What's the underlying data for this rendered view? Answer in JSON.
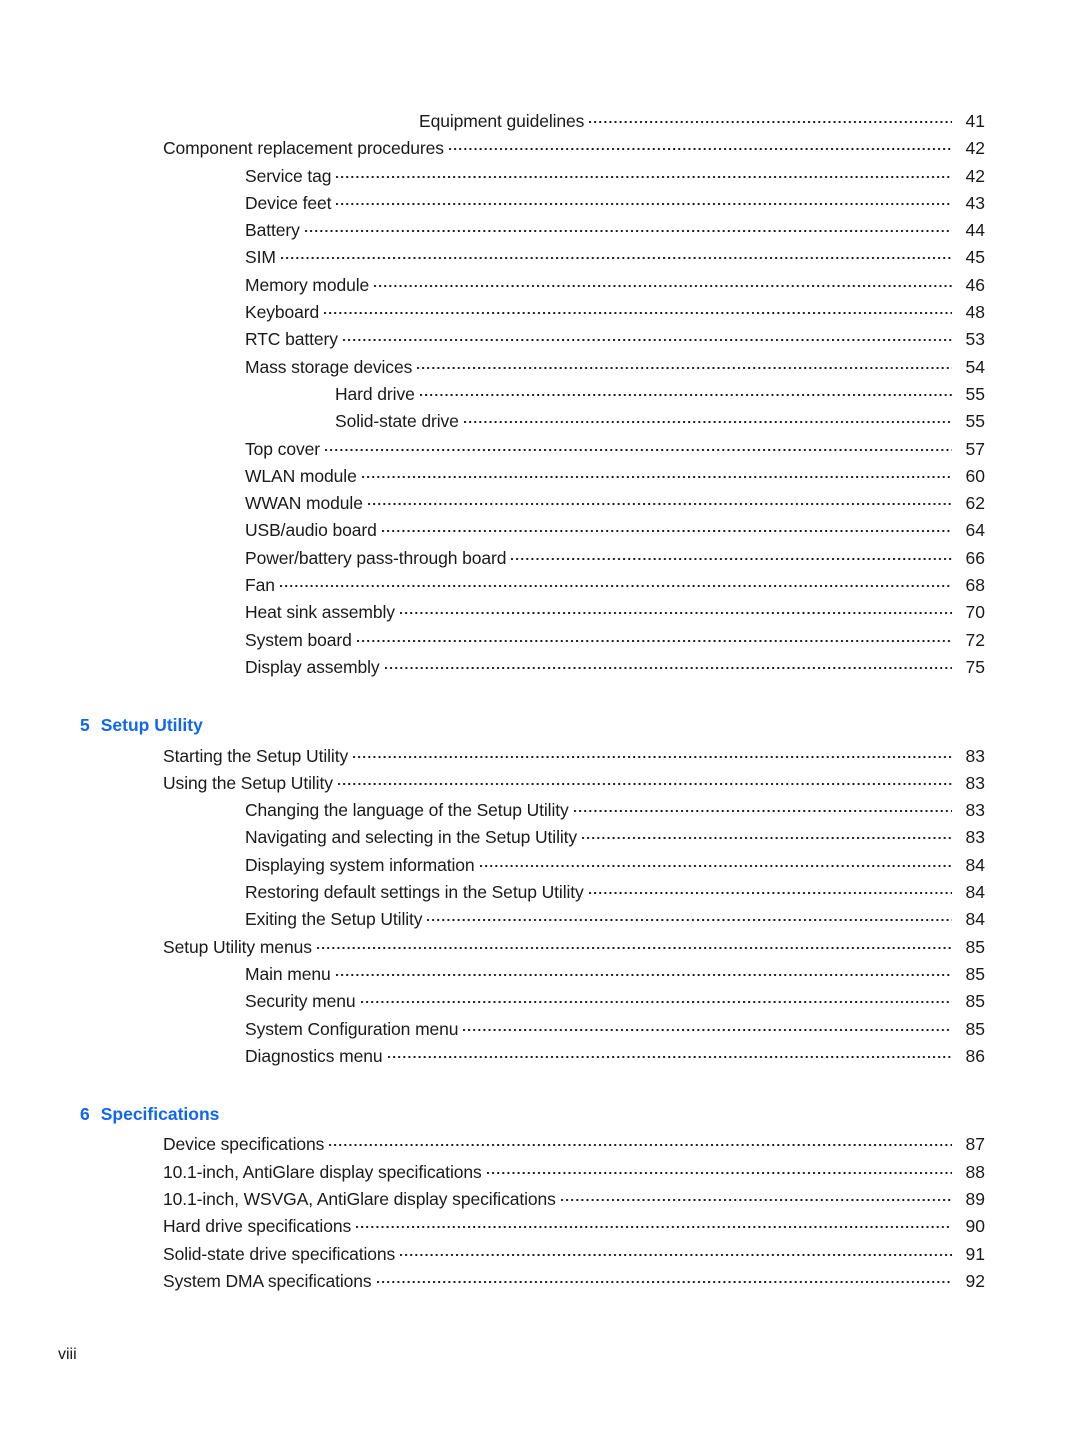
{
  "document": {
    "type": "table-of-contents",
    "footer_page_label": "viii"
  },
  "toc": {
    "blocks": [
      {
        "kind": "entries",
        "entries": [
          {
            "level": 4,
            "title": "Equipment guidelines",
            "page": "41"
          },
          {
            "level": 1,
            "title": "Component replacement procedures",
            "page": "42"
          },
          {
            "level": 2,
            "title": "Service tag",
            "page": "42"
          },
          {
            "level": 2,
            "title": "Device feet",
            "page": "43"
          },
          {
            "level": 2,
            "title": "Battery",
            "page": "44"
          },
          {
            "level": 2,
            "title": "SIM",
            "page": "45"
          },
          {
            "level": 2,
            "title": "Memory module",
            "page": "46"
          },
          {
            "level": 2,
            "title": "Keyboard",
            "page": "48"
          },
          {
            "level": 2,
            "title": "RTC battery",
            "page": "53"
          },
          {
            "level": 2,
            "title": "Mass storage devices",
            "page": "54"
          },
          {
            "level": 3,
            "title": "Hard drive",
            "page": "55"
          },
          {
            "level": 3,
            "title": "Solid-state drive",
            "page": "55"
          },
          {
            "level": 2,
            "title": "Top cover",
            "page": "57"
          },
          {
            "level": 2,
            "title": "WLAN module",
            "page": "60"
          },
          {
            "level": 2,
            "title": "WWAN module",
            "page": "62"
          },
          {
            "level": 2,
            "title": "USB/audio board",
            "page": "64"
          },
          {
            "level": 2,
            "title": "Power/battery pass-through board",
            "page": "66"
          },
          {
            "level": 2,
            "title": "Fan",
            "page": "68"
          },
          {
            "level": 2,
            "title": "Heat sink assembly",
            "page": "70"
          },
          {
            "level": 2,
            "title": "System board",
            "page": "72"
          },
          {
            "level": 2,
            "title": "Display assembly",
            "page": "75"
          }
        ]
      },
      {
        "kind": "chapter",
        "number": "5",
        "title": "Setup Utility",
        "entries": [
          {
            "level": 1,
            "title": "Starting the Setup Utility",
            "page": "83"
          },
          {
            "level": 1,
            "title": "Using the Setup Utility",
            "page": "83"
          },
          {
            "level": 2,
            "title": "Changing the language of the Setup Utility",
            "page": "83"
          },
          {
            "level": 2,
            "title": "Navigating and selecting in the Setup Utility",
            "page": "83"
          },
          {
            "level": 2,
            "title": "Displaying system information",
            "page": "84"
          },
          {
            "level": 2,
            "title": "Restoring default settings in the Setup Utility",
            "page": "84"
          },
          {
            "level": 2,
            "title": "Exiting the Setup Utility",
            "page": "84"
          },
          {
            "level": 1,
            "title": "Setup Utility menus",
            "page": "85"
          },
          {
            "level": 2,
            "title": "Main menu",
            "page": "85"
          },
          {
            "level": 2,
            "title": "Security menu",
            "page": "85"
          },
          {
            "level": 2,
            "title": "System Configuration menu",
            "page": "85"
          },
          {
            "level": 2,
            "title": "Diagnostics menu",
            "page": "86"
          }
        ]
      },
      {
        "kind": "chapter",
        "number": "6",
        "title": "Specifications",
        "entries": [
          {
            "level": 1,
            "title": "Device specifications",
            "page": "87"
          },
          {
            "level": 1,
            "title": "10.1-inch, AntiGlare display specifications",
            "page": "88"
          },
          {
            "level": 1,
            "title": "10.1-inch, WSVGA, AntiGlare display specifications",
            "page": "89"
          },
          {
            "level": 1,
            "title": "Hard drive specifications",
            "page": "90"
          },
          {
            "level": 1,
            "title": "Solid-state drive specifications",
            "page": "91"
          },
          {
            "level": 1,
            "title": "System DMA specifications",
            "page": "92"
          }
        ]
      }
    ]
  },
  "colors": {
    "chapter_heading": "#1166ee",
    "body_text": "#1a1a1a",
    "page_background": "#ffffff"
  }
}
